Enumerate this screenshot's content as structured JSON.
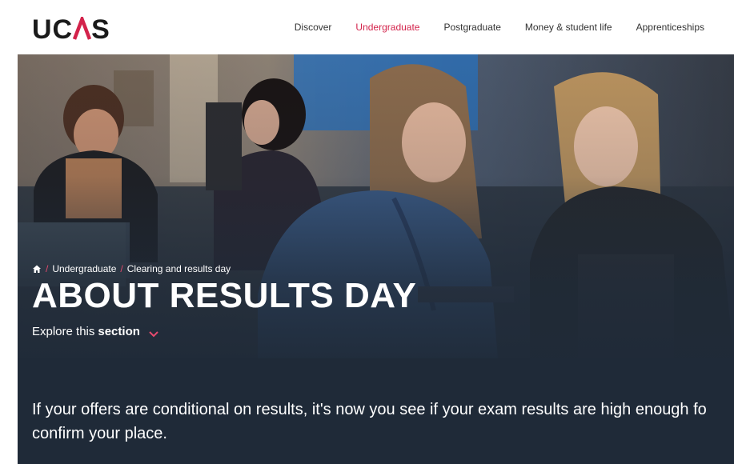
{
  "brand": {
    "logo_text_left": "UC",
    "logo_text_right": "S"
  },
  "nav": {
    "items": [
      {
        "label": "Discover",
        "active": false
      },
      {
        "label": "Undergraduate",
        "active": true
      },
      {
        "label": "Postgraduate",
        "active": false
      },
      {
        "label": "Money & student life",
        "active": false
      },
      {
        "label": "Apprenticeships",
        "active": false
      }
    ]
  },
  "breadcrumb": {
    "items": [
      "Undergraduate",
      "Clearing and results day"
    ],
    "separator": "/"
  },
  "page": {
    "title": "ABOUT RESULTS DAY",
    "explore_prefix": "Explore this",
    "explore_strong": "section",
    "intro_line1": "If your offers are conditional on results, it's now you see if your exam results are high enough fo",
    "intro_line2": "confirm your place."
  },
  "colors": {
    "accent": "#d3234b",
    "hero_bg": "#1f2a38",
    "header_bg": "#ffffff"
  },
  "icons": {
    "home": "home-icon",
    "explore": "chevron-down-icon"
  }
}
